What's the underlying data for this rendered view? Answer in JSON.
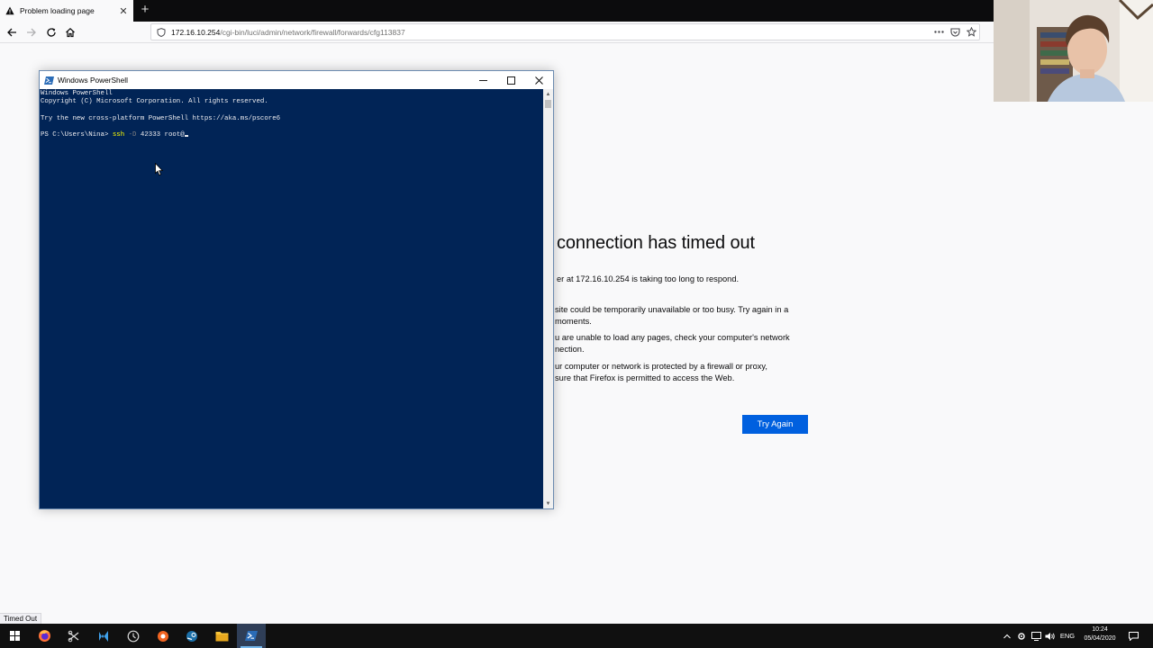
{
  "browser": {
    "tab": {
      "title": "Problem loading page",
      "close": "✕"
    },
    "new_tab": "+",
    "url": {
      "host": "172.16.10.254",
      "path": "/cgi-bin/luci/admin/network/firewall/forwards/cfg113837"
    }
  },
  "error_page": {
    "title": "connection has timed out",
    "subtitle": "er at 172.16.10.254 is taking too long to respond.",
    "bullets": [
      [
        "site could be temporarily unavailable or too busy. Try again in a",
        "moments."
      ],
      [
        "u are unable to load any pages, check your computer's network",
        "nection."
      ],
      [
        "ur computer or network is protected by a firewall or proxy,",
        " sure that Firefox is permitted to access the Web."
      ]
    ],
    "try_again": "Try Again"
  },
  "status_bar": {
    "text": "Timed Out"
  },
  "powershell": {
    "title": "Windows PowerShell",
    "lines": [
      "Windows PowerShell",
      "Copyright (C) Microsoft Corporation. All rights reserved.",
      "",
      "Try the new cross-platform PowerShell https://aka.ms/pscore6",
      ""
    ],
    "prompt": "PS C:\\Users\\Nina> ",
    "cmd": "ssh",
    "flag": " -D",
    "args": " 42333 root@"
  },
  "taskbar": {
    "items": [
      "windows-start-icon",
      "firefox-icon",
      "snipping-tool-icon",
      "visual-studio-icon",
      "clock-app-icon",
      "orange-app-icon",
      "steam-icon",
      "file-explorer-icon",
      "powershell-icon"
    ],
    "tray": {
      "language": "ENG"
    },
    "clock": {
      "time": "10:24",
      "date": "05/04/2020"
    }
  },
  "colors": {
    "console_bg": "#012456",
    "accent": "#0060df",
    "taskbar": "#101010"
  }
}
